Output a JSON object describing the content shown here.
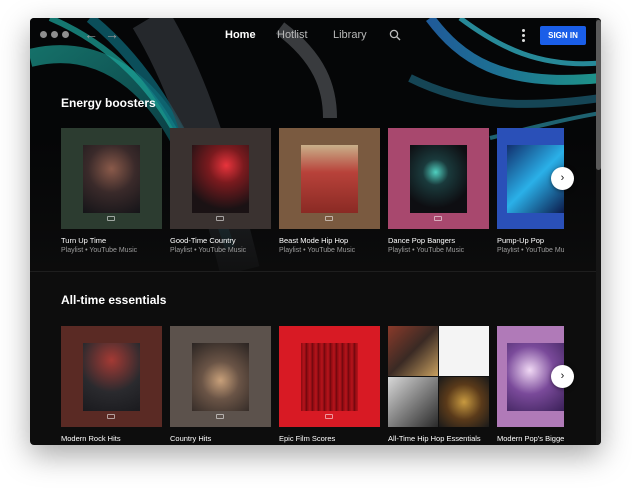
{
  "nav": {
    "back_icon": "arrow-left-icon",
    "forward_icon": "arrow-right-icon",
    "links": [
      "Home",
      "Hotlist",
      "Library"
    ],
    "active": "Home",
    "search_icon": "search-icon",
    "menu_icon": "more-vert-icon",
    "signin_label": "SIGN IN"
  },
  "sections": [
    {
      "title": "Energy boosters",
      "items": [
        {
          "title": "Turn Up Time",
          "subtitle": "Playlist • YouTube Music"
        },
        {
          "title": "Good-Time Country",
          "subtitle": "Playlist • YouTube Music"
        },
        {
          "title": "Beast Mode Hip Hop",
          "subtitle": "Playlist • YouTube Music"
        },
        {
          "title": "Dance Pop Bangers",
          "subtitle": "Playlist • YouTube Music"
        },
        {
          "title": "Pump-Up Pop",
          "subtitle": "Playlist • YouTube Music"
        }
      ]
    },
    {
      "title": "All-time essentials",
      "items": [
        {
          "title": "Modern Rock Hits",
          "subtitle": ""
        },
        {
          "title": "Country Hits",
          "subtitle": ""
        },
        {
          "title": "Epic Film Scores",
          "subtitle": ""
        },
        {
          "title": "All-Time Hip Hop Essentials",
          "subtitle": ""
        },
        {
          "title": "Modern Pop's Biggest Hits",
          "subtitle": ""
        }
      ]
    }
  ],
  "next_icon": "chevron-right-icon",
  "colors": {
    "accent": "#1a5ee8",
    "background": "#0d0d0d"
  }
}
